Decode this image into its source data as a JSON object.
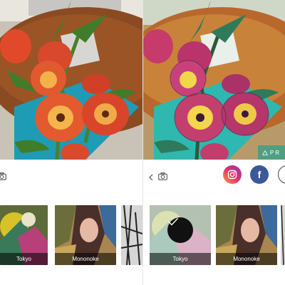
{
  "filters": {
    "left": [
      {
        "label": "Tokyo"
      },
      {
        "label": "Mononoke"
      }
    ],
    "right": [
      {
        "label": "Tokyo"
      },
      {
        "label": "Mononoke"
      }
    ]
  },
  "badge": {
    "text": "PR"
  },
  "share": {
    "facebook_letter": "f"
  },
  "icons": [
    "camera-icon",
    "back-chevron-icon",
    "instagram-icon",
    "facebook-icon",
    "checkmark-icon",
    "warning-triangle-icon"
  ],
  "colors": {
    "instagram_gradient_start": "#f9a23a",
    "instagram_gradient_end": "#8a3ab9",
    "facebook": "#3b5998",
    "selected_check_bg": "#111111"
  }
}
